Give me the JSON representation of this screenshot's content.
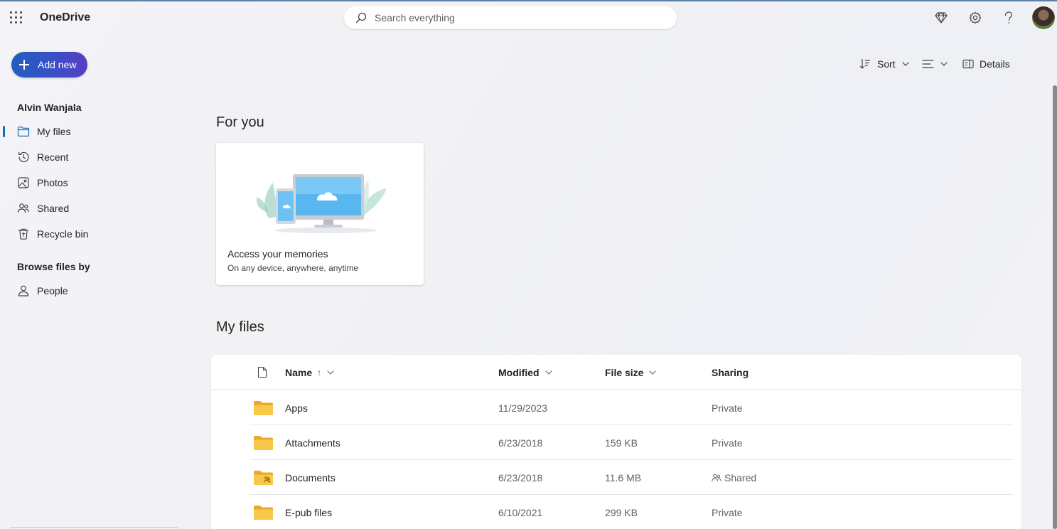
{
  "header": {
    "app_name": "OneDrive",
    "search_placeholder": "Search everything",
    "icons": [
      "waffle-icon",
      "premium-diamond-icon",
      "settings-gear-icon",
      "help-icon"
    ]
  },
  "sidebar": {
    "add_new_label": "Add new",
    "user_name": "Alvin Wanjala",
    "items": [
      {
        "label": "My files",
        "icon": "folder-icon",
        "active": true
      },
      {
        "label": "Recent",
        "icon": "recent-clock-icon",
        "active": false
      },
      {
        "label": "Photos",
        "icon": "photos-icon",
        "active": false
      },
      {
        "label": "Shared",
        "icon": "shared-people-icon",
        "active": false
      },
      {
        "label": "Recycle bin",
        "icon": "recycle-bin-icon",
        "active": false
      }
    ],
    "browse_heading": "Browse files by",
    "browse_items": [
      {
        "label": "People",
        "icon": "person-icon"
      }
    ]
  },
  "commandbar": {
    "sort_label": "Sort",
    "details_label": "Details"
  },
  "for_you": {
    "title": "For you",
    "card_title": "Access your memories",
    "card_subtitle": "On any device, anywhere, anytime"
  },
  "my_files": {
    "title": "My files",
    "columns": {
      "name": "Name",
      "name_sort_indicator": "↑",
      "modified": "Modified",
      "file_size": "File size",
      "sharing": "Sharing"
    },
    "rows": [
      {
        "name": "Apps",
        "modified": "11/29/2023",
        "size": "",
        "sharing": "Private",
        "shared_folder": false
      },
      {
        "name": "Attachments",
        "modified": "6/23/2018",
        "size": "159 KB",
        "sharing": "Private",
        "shared_folder": false
      },
      {
        "name": "Documents",
        "modified": "6/23/2018",
        "size": "11.6 MB",
        "sharing": "Shared",
        "shared_folder": true
      },
      {
        "name": "E-pub files",
        "modified": "6/10/2021",
        "size": "299 KB",
        "sharing": "Private",
        "shared_folder": false
      }
    ]
  },
  "colors": {
    "accent": "#0f6cbd",
    "add_new_gradient_start": "#1f5fbf",
    "add_new_gradient_end": "#5540c0",
    "folder": "#f8c84a"
  }
}
